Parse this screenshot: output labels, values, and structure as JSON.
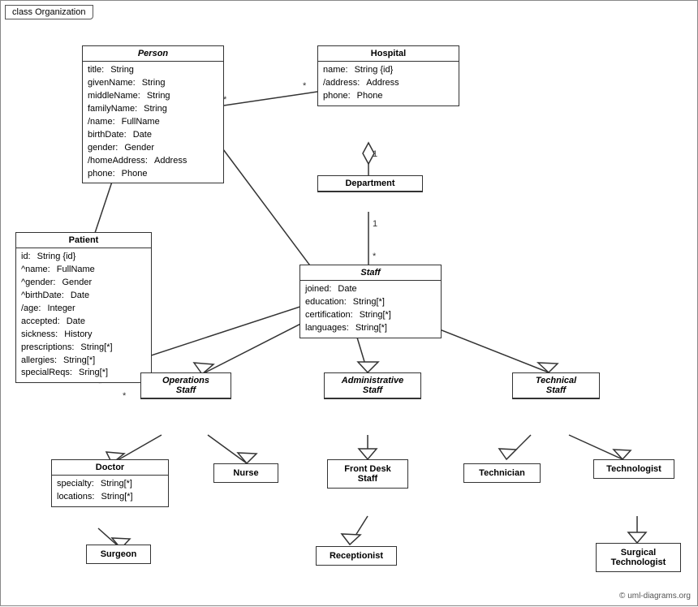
{
  "title": "class Organization",
  "copyright": "© uml-diagrams.org",
  "classes": {
    "person": {
      "title": "Person",
      "italic": true,
      "attrs": [
        {
          "name": "title:",
          "type": "String"
        },
        {
          "name": "givenName:",
          "type": "String"
        },
        {
          "name": "middleName:",
          "type": "String"
        },
        {
          "name": "familyName:",
          "type": "String"
        },
        {
          "name": "/name:",
          "type": "FullName"
        },
        {
          "name": "birthDate:",
          "type": "Date"
        },
        {
          "name": "gender:",
          "type": "Gender"
        },
        {
          "name": "/homeAddress:",
          "type": "Address"
        },
        {
          "name": "phone:",
          "type": "Phone"
        }
      ]
    },
    "hospital": {
      "title": "Hospital",
      "italic": false,
      "attrs": [
        {
          "name": "name:",
          "type": "String {id}"
        },
        {
          "name": "/address:",
          "type": "Address"
        },
        {
          "name": "phone:",
          "type": "Phone"
        }
      ]
    },
    "patient": {
      "title": "Patient",
      "italic": false,
      "attrs": [
        {
          "name": "id:",
          "type": "String {id}"
        },
        {
          "name": "^name:",
          "type": "FullName"
        },
        {
          "name": "^gender:",
          "type": "Gender"
        },
        {
          "name": "^birthDate:",
          "type": "Date"
        },
        {
          "name": "/age:",
          "type": "Integer"
        },
        {
          "name": "accepted:",
          "type": "Date"
        },
        {
          "name": "sickness:",
          "type": "History"
        },
        {
          "name": "prescriptions:",
          "type": "String[*]"
        },
        {
          "name": "allergies:",
          "type": "String[*]"
        },
        {
          "name": "specialReqs:",
          "type": "Sring[*]"
        }
      ]
    },
    "department": {
      "title": "Department",
      "italic": false,
      "attrs": []
    },
    "staff": {
      "title": "Staff",
      "italic": true,
      "attrs": [
        {
          "name": "joined:",
          "type": "Date"
        },
        {
          "name": "education:",
          "type": "String[*]"
        },
        {
          "name": "certification:",
          "type": "String[*]"
        },
        {
          "name": "languages:",
          "type": "String[*]"
        }
      ]
    },
    "operations_staff": {
      "title": "Operations\nStaff",
      "italic": true
    },
    "administrative_staff": {
      "title": "Administrative\nStaff",
      "italic": true
    },
    "technical_staff": {
      "title": "Technical\nStaff",
      "italic": true
    },
    "doctor": {
      "title": "Doctor",
      "italic": false,
      "attrs": [
        {
          "name": "specialty:",
          "type": "String[*]"
        },
        {
          "name": "locations:",
          "type": "String[*]"
        }
      ]
    },
    "nurse": {
      "title": "Nurse",
      "italic": false,
      "attrs": []
    },
    "front_desk_staff": {
      "title": "Front Desk\nStaff",
      "italic": false,
      "attrs": []
    },
    "technician": {
      "title": "Technician",
      "italic": false,
      "attrs": []
    },
    "technologist": {
      "title": "Technologist",
      "italic": false,
      "attrs": []
    },
    "surgeon": {
      "title": "Surgeon",
      "italic": false,
      "attrs": []
    },
    "receptionist": {
      "title": "Receptionist",
      "italic": false,
      "attrs": []
    },
    "surgical_technologist": {
      "title": "Surgical\nTechnologist",
      "italic": false,
      "attrs": []
    }
  }
}
